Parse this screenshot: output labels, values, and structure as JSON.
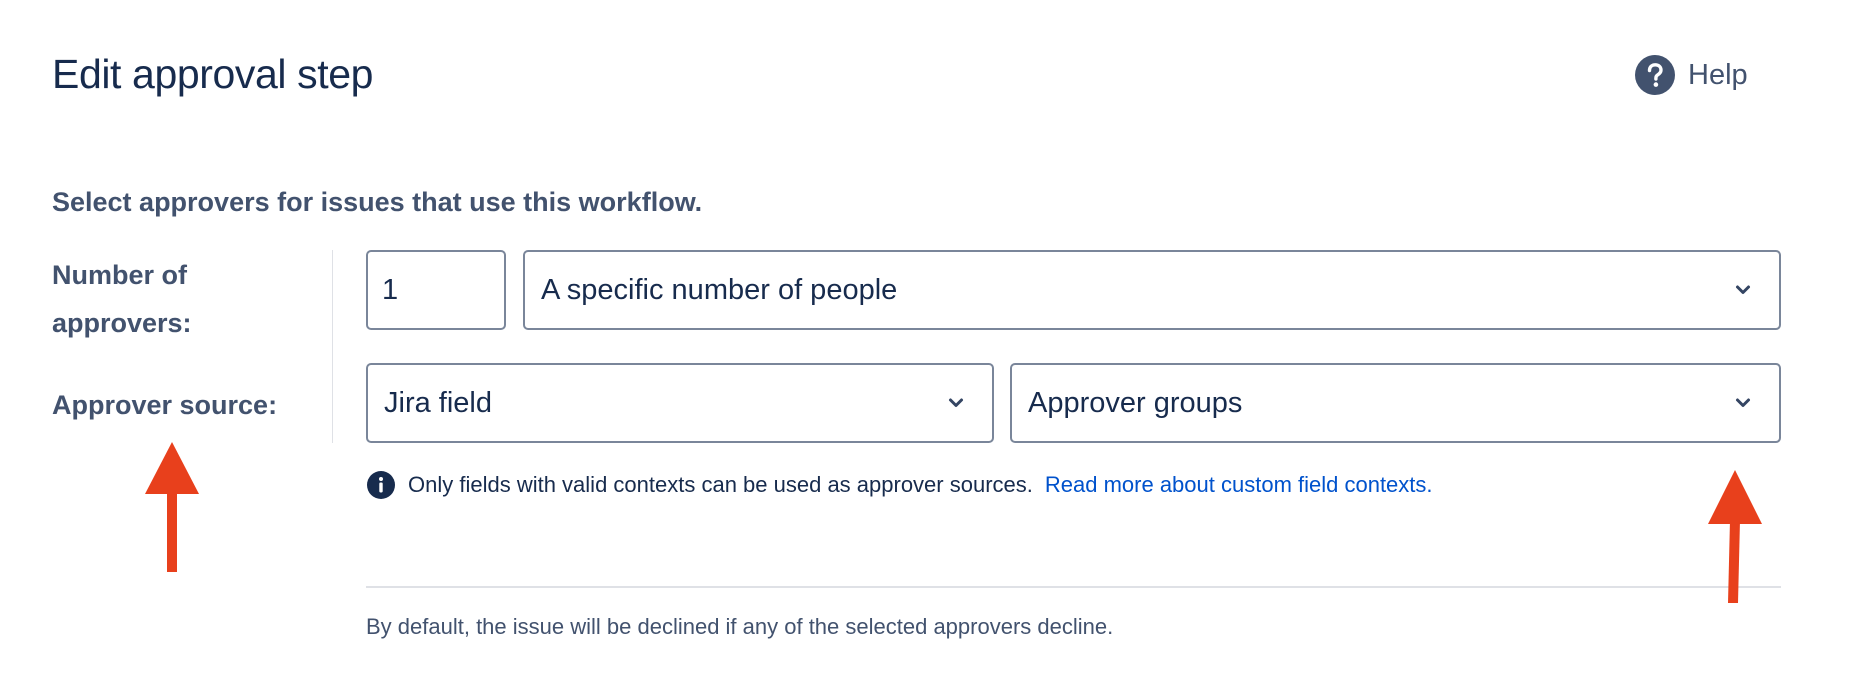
{
  "header": {
    "title": "Edit approval step",
    "help_label": "Help"
  },
  "form": {
    "intro": "Select approvers for issues that use this workflow.",
    "number_label": "Number of approvers:",
    "number_value": "1",
    "number_mode": "A specific number of people",
    "source_label": "Approver source:",
    "source_type": "Jira field",
    "source_field": "Approver groups"
  },
  "info": {
    "text": "Only fields with valid contexts can be used as approver sources.",
    "link": "Read more about custom field contexts."
  },
  "footer": {
    "note": "By default, the issue will be declined if any of the selected approvers decline."
  },
  "annotations": {
    "arrow_color": "#e8401c"
  },
  "colors": {
    "text": "#172b4d",
    "subtle_text": "#42526e",
    "link": "#0052cc",
    "border": "#7a869a",
    "divider": "#dfe1e6"
  }
}
